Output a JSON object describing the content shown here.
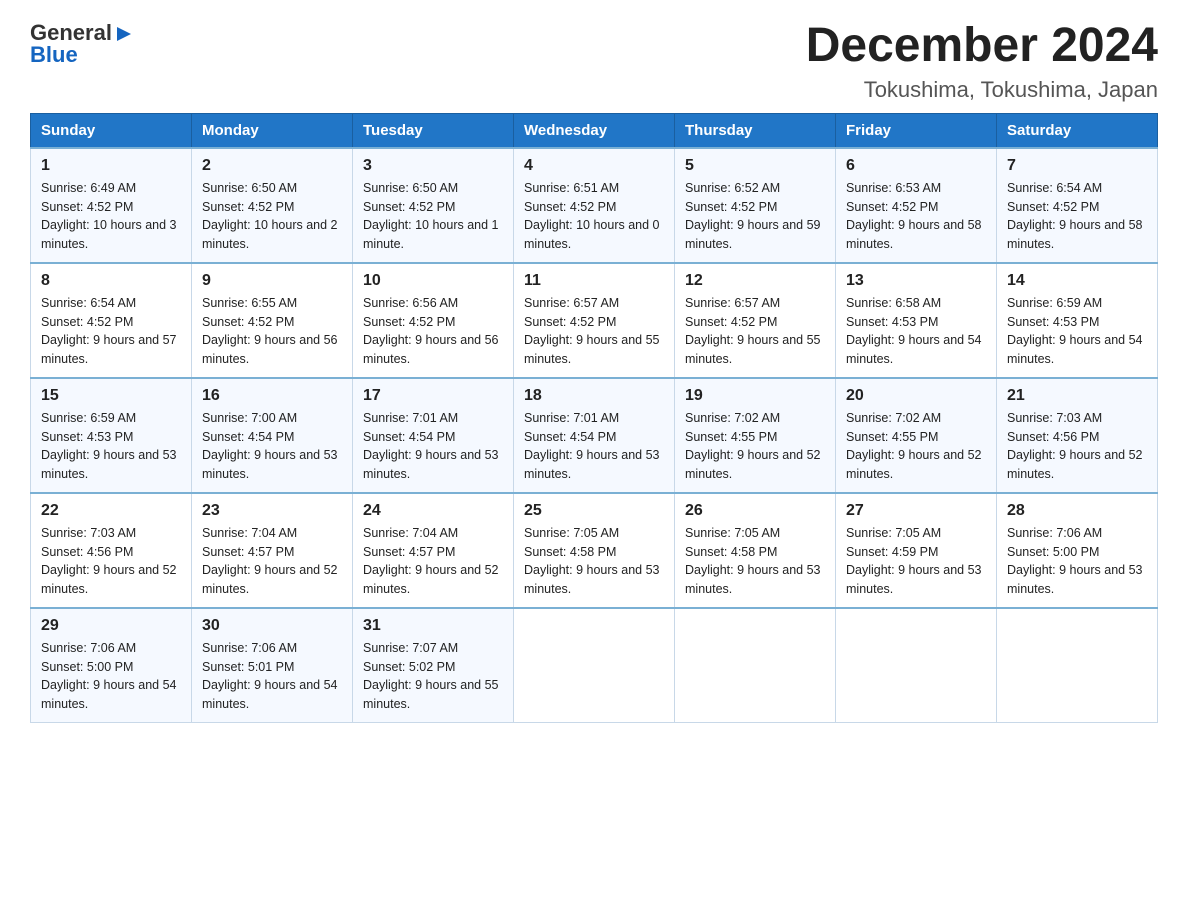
{
  "logo": {
    "text_general": "General",
    "text_blue": "Blue"
  },
  "header": {
    "month_title": "December 2024",
    "location": "Tokushima, Tokushima, Japan"
  },
  "days_of_week": [
    "Sunday",
    "Monday",
    "Tuesday",
    "Wednesday",
    "Thursday",
    "Friday",
    "Saturday"
  ],
  "weeks": [
    [
      {
        "day": "1",
        "sunrise": "6:49 AM",
        "sunset": "4:52 PM",
        "daylight": "10 hours and 3 minutes."
      },
      {
        "day": "2",
        "sunrise": "6:50 AM",
        "sunset": "4:52 PM",
        "daylight": "10 hours and 2 minutes."
      },
      {
        "day": "3",
        "sunrise": "6:50 AM",
        "sunset": "4:52 PM",
        "daylight": "10 hours and 1 minute."
      },
      {
        "day": "4",
        "sunrise": "6:51 AM",
        "sunset": "4:52 PM",
        "daylight": "10 hours and 0 minutes."
      },
      {
        "day": "5",
        "sunrise": "6:52 AM",
        "sunset": "4:52 PM",
        "daylight": "9 hours and 59 minutes."
      },
      {
        "day": "6",
        "sunrise": "6:53 AM",
        "sunset": "4:52 PM",
        "daylight": "9 hours and 58 minutes."
      },
      {
        "day": "7",
        "sunrise": "6:54 AM",
        "sunset": "4:52 PM",
        "daylight": "9 hours and 58 minutes."
      }
    ],
    [
      {
        "day": "8",
        "sunrise": "6:54 AM",
        "sunset": "4:52 PM",
        "daylight": "9 hours and 57 minutes."
      },
      {
        "day": "9",
        "sunrise": "6:55 AM",
        "sunset": "4:52 PM",
        "daylight": "9 hours and 56 minutes."
      },
      {
        "day": "10",
        "sunrise": "6:56 AM",
        "sunset": "4:52 PM",
        "daylight": "9 hours and 56 minutes."
      },
      {
        "day": "11",
        "sunrise": "6:57 AM",
        "sunset": "4:52 PM",
        "daylight": "9 hours and 55 minutes."
      },
      {
        "day": "12",
        "sunrise": "6:57 AM",
        "sunset": "4:52 PM",
        "daylight": "9 hours and 55 minutes."
      },
      {
        "day": "13",
        "sunrise": "6:58 AM",
        "sunset": "4:53 PM",
        "daylight": "9 hours and 54 minutes."
      },
      {
        "day": "14",
        "sunrise": "6:59 AM",
        "sunset": "4:53 PM",
        "daylight": "9 hours and 54 minutes."
      }
    ],
    [
      {
        "day": "15",
        "sunrise": "6:59 AM",
        "sunset": "4:53 PM",
        "daylight": "9 hours and 53 minutes."
      },
      {
        "day": "16",
        "sunrise": "7:00 AM",
        "sunset": "4:54 PM",
        "daylight": "9 hours and 53 minutes."
      },
      {
        "day": "17",
        "sunrise": "7:01 AM",
        "sunset": "4:54 PM",
        "daylight": "9 hours and 53 minutes."
      },
      {
        "day": "18",
        "sunrise": "7:01 AM",
        "sunset": "4:54 PM",
        "daylight": "9 hours and 53 minutes."
      },
      {
        "day": "19",
        "sunrise": "7:02 AM",
        "sunset": "4:55 PM",
        "daylight": "9 hours and 52 minutes."
      },
      {
        "day": "20",
        "sunrise": "7:02 AM",
        "sunset": "4:55 PM",
        "daylight": "9 hours and 52 minutes."
      },
      {
        "day": "21",
        "sunrise": "7:03 AM",
        "sunset": "4:56 PM",
        "daylight": "9 hours and 52 minutes."
      }
    ],
    [
      {
        "day": "22",
        "sunrise": "7:03 AM",
        "sunset": "4:56 PM",
        "daylight": "9 hours and 52 minutes."
      },
      {
        "day": "23",
        "sunrise": "7:04 AM",
        "sunset": "4:57 PM",
        "daylight": "9 hours and 52 minutes."
      },
      {
        "day": "24",
        "sunrise": "7:04 AM",
        "sunset": "4:57 PM",
        "daylight": "9 hours and 52 minutes."
      },
      {
        "day": "25",
        "sunrise": "7:05 AM",
        "sunset": "4:58 PM",
        "daylight": "9 hours and 53 minutes."
      },
      {
        "day": "26",
        "sunrise": "7:05 AM",
        "sunset": "4:58 PM",
        "daylight": "9 hours and 53 minutes."
      },
      {
        "day": "27",
        "sunrise": "7:05 AM",
        "sunset": "4:59 PM",
        "daylight": "9 hours and 53 minutes."
      },
      {
        "day": "28",
        "sunrise": "7:06 AM",
        "sunset": "5:00 PM",
        "daylight": "9 hours and 53 minutes."
      }
    ],
    [
      {
        "day": "29",
        "sunrise": "7:06 AM",
        "sunset": "5:00 PM",
        "daylight": "9 hours and 54 minutes."
      },
      {
        "day": "30",
        "sunrise": "7:06 AM",
        "sunset": "5:01 PM",
        "daylight": "9 hours and 54 minutes."
      },
      {
        "day": "31",
        "sunrise": "7:07 AM",
        "sunset": "5:02 PM",
        "daylight": "9 hours and 55 minutes."
      },
      null,
      null,
      null,
      null
    ]
  ],
  "labels": {
    "sunrise": "Sunrise:",
    "sunset": "Sunset:",
    "daylight": "Daylight:"
  }
}
